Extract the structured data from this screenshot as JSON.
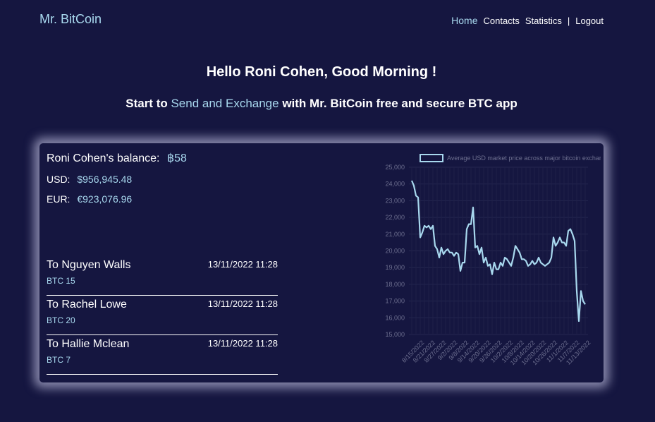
{
  "app": {
    "title": "Mr. BitCoin"
  },
  "nav": {
    "home": "Home",
    "contacts": "Contacts",
    "statistics": "Statistics",
    "separator": "|",
    "logout": "Logout"
  },
  "hero": {
    "greeting": "Hello Roni Cohen, Good Morning !",
    "tagline_prefix": "Start to",
    "tagline_highlight": "Send and Exchange",
    "tagline_suffix": "with Mr. BitCoin free and secure BTC app"
  },
  "balance": {
    "label": "Roni Cohen's balance:",
    "btc": "฿58",
    "usd_label": "USD:",
    "usd_value": "$956,945.48",
    "eur_label": "EUR:",
    "eur_value": "€923,076.96"
  },
  "moves": [
    {
      "to": "To Nguyen Walls",
      "date": "13/11/2022  11:28",
      "amount": "BTC 15"
    },
    {
      "to": "To Rachel Lowe",
      "date": "13/11/2022  11:28",
      "amount": "BTC 20"
    },
    {
      "to": "To Hallie Mclean",
      "date": "13/11/2022  11:28",
      "amount": "BTC 7"
    }
  ],
  "colors": {
    "background": "#151640",
    "accent": "#a8d8ee",
    "text": "#ffffff"
  },
  "chart_data": {
    "type": "line",
    "legend": "Average USD market price across major bitcoin exchanges.",
    "legend_position": "top",
    "ylim": [
      15000,
      25000
    ],
    "y_ticks": [
      "15,000",
      "16,000",
      "17,000",
      "18,000",
      "19,000",
      "20,000",
      "21,000",
      "22,000",
      "23,000",
      "24,000",
      "25,000"
    ],
    "x_ticks": [
      "8/15/2022",
      "8/21/2022",
      "8/27/2022",
      "9/2/2022",
      "9/8/2022",
      "9/14/2022",
      "9/20/2022",
      "9/26/2022",
      "10/2/2022",
      "10/8/2022",
      "10/14/2022",
      "10/20/2022",
      "10/26/2022",
      "11/1/2022",
      "11/7/2022",
      "11/13/2022"
    ],
    "grid": true,
    "series": [
      {
        "values": [
          24200,
          23900,
          23300,
          23200,
          20800,
          21100,
          21500,
          21400,
          21500,
          21300,
          21500,
          20300,
          20100,
          19600,
          20200,
          19800,
          20000,
          20100,
          19900,
          19900,
          19700,
          19900,
          19800,
          18800,
          19300,
          19300,
          21300,
          21600,
          21600,
          22600,
          20200,
          20300,
          19800,
          20200,
          19300,
          19600,
          19100,
          19200,
          18600,
          19300,
          18900,
          18900,
          19300,
          19100,
          19600,
          19500,
          19300,
          19100,
          19600,
          20300,
          20100,
          19900,
          19500,
          19500,
          19400,
          19100,
          19200,
          19400,
          19200,
          19300,
          19600,
          19300,
          19200,
          19100,
          19200,
          19300,
          19600,
          20800,
          20300,
          20500,
          20800,
          20500,
          20500,
          20300,
          21200,
          21300,
          21000,
          20600,
          17600,
          15800,
          17600,
          17000,
          16800
        ]
      }
    ]
  }
}
